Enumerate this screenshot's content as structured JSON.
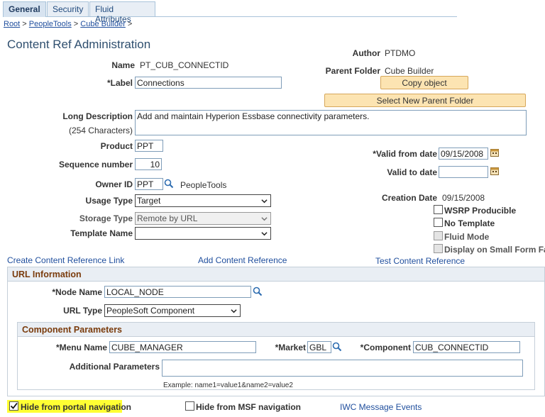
{
  "tabs": [
    {
      "label": "General",
      "active": true
    },
    {
      "label": "Security",
      "active": false
    },
    {
      "label": "Fluid Attributes",
      "active": false
    }
  ],
  "breadcrumb": {
    "root": "Root",
    "sep1": " > ",
    "peopletools": "PeopleTools",
    "sep2": " > ",
    "cube_builder": "Cube Builder",
    "sep3": " >"
  },
  "page_title": "Content Ref Administration",
  "form": {
    "name_label": "Name",
    "name_value": "PT_CUB_CONNECTID",
    "label_label": "*Label",
    "label_value": "Connections",
    "author_label": "Author",
    "author_value": "PTDMO",
    "parent_folder_label": "Parent Folder",
    "parent_folder_value": "Cube Builder",
    "copy_object_button": "Copy object",
    "select_parent_button": "Select New Parent Folder",
    "long_desc_label": "Long Description",
    "long_desc_hint": "(254 Characters)",
    "long_desc_value": "Add and maintain Hyperion Essbase connectivity parameters.",
    "product_label": "Product",
    "product_value": "PPT",
    "sequence_label": "Sequence number",
    "sequence_value": "10",
    "owner_label": "Owner ID",
    "owner_value": "PPT",
    "owner_desc": "PeopleTools",
    "usage_label": "Usage Type",
    "usage_value": "Target",
    "storage_label": "Storage Type",
    "storage_value": "Remote by URL",
    "template_label": "Template Name",
    "template_value": "",
    "valid_from_label": "*Valid from date",
    "valid_from_value": "09/15/2008",
    "valid_to_label": "Valid to date",
    "valid_to_value": "",
    "creation_label": "Creation Date",
    "creation_value": "09/15/2008",
    "wsrp_label": "WSRP Producible",
    "wsrp_checked": false,
    "no_template_label": "No Template",
    "no_template_checked": false,
    "fluid_label": "Fluid Mode",
    "small_form_label": "Display on Small Form Fact"
  },
  "links": {
    "create_link": "Create Content Reference Link",
    "add_ref": "Add Content Reference",
    "test_ref": "Test Content Reference"
  },
  "url_info": {
    "header": "URL Information",
    "node_label": "*Node Name",
    "node_value": "LOCAL_NODE",
    "url_type_label": "URL Type",
    "url_type_value": "PeopleSoft Component"
  },
  "component_params": {
    "header": "Component Parameters",
    "menu_label": "*Menu Name",
    "menu_value": "CUBE_MANAGER",
    "market_label": "*Market",
    "market_value": "GBL",
    "component_label": "*Component",
    "component_value": "CUB_CONNECTID",
    "additional_label": "Additional Parameters",
    "additional_value": "",
    "example_text": "Example: name1=value1&name2=value2"
  },
  "bottom": {
    "hide_portal_label": "Hide from portal navigation",
    "hide_portal_checked": true,
    "hide_msf_label": "Hide from MSF navigation",
    "hide_msf_checked": false,
    "iwc_link": "IWC Message Events"
  },
  "colors": {
    "tab_active_bg": "#d7e3f0",
    "button_bg": "#fce4b2",
    "link": "#1f4e9d",
    "header_text": "#7a3b0c",
    "highlight": "#ffff33"
  }
}
